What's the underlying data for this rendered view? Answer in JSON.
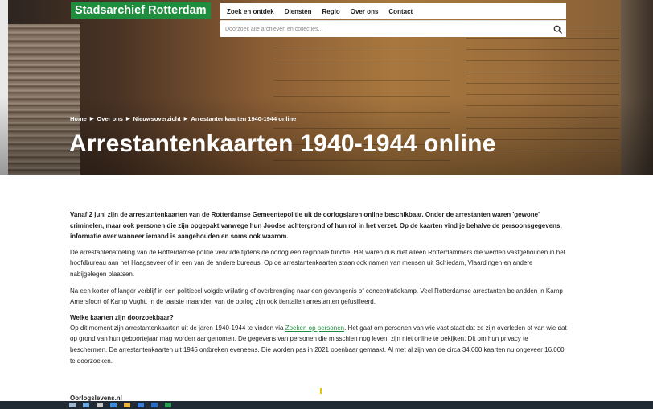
{
  "header": {
    "logo_text": "Stadsarchief Rotterdam",
    "nav": [
      {
        "label": "Zoek en ontdek"
      },
      {
        "label": "Diensten"
      },
      {
        "label": "Regio"
      },
      {
        "label": "Over ons"
      },
      {
        "label": "Contact"
      }
    ],
    "search_placeholder": "Doorzoek alle archieven en collecties...",
    "search_icon": "search-icon"
  },
  "breadcrumb": [
    "Home",
    "Over ons",
    "Nieuwsoverzicht",
    "Arrestantenkaarten 1940-1944 online"
  ],
  "page_title": "Arrestantenkaarten 1940-1944 online",
  "article": {
    "intro": "Vanaf 2 juni zijn de arrestantenkaarten van de Rotterdamse Gemeentepolitie uit de oorlogsjaren online beschikbaar. Onder de arrestanten waren 'gewone' criminelen, maar ook personen die zijn opgepakt vanwege hun Joodse achtergrond of hun rol in het verzet. Op de kaarten vind je behalve de persoonsgegevens, informatie over wanneer iemand is aangehouden en soms ook waarom.",
    "p1": "De arrestantenafdeling van de Rotterdamse politie vervulde tijdens de oorlog een regionale functie. Het waren dus niet alleen Rotterdammers die werden vastgehouden in het hoofdbureau aan het Haagseveer of in een van de andere bureaus. Op de arrestantenkaarten staan ook namen van mensen uit Schiedam, Vlaardingen en andere nabijgelegen plaatsen.",
    "p2": "Na een korter of langer verblijf in een politiecel volgde vrijlating of overbrenging naar een gevangenis of concentratiekamp. Veel Rotterdamse arrestanten belandden in Kamp Amersfoort of Kamp Vught. In de laatste maanden van de oorlog zijn ook tientallen arrestanten gefusilleerd.",
    "section_title": "Welke kaarten zijn doorzoekbaar?",
    "p3_before": "Op dit moment zijn arrestantenkaarten uit de jaren 1940-1944 te vinden via ",
    "p3_link": "Zoeken op personen",
    "p3_after": ". Het gaat om personen van wie vast staat dat ze zijn overleden of van wie dat op grond van hun geboortejaar mag worden aangenomen. De gegevens van personen die misschien nog leven, zijn niet online te bekijken. Dit om hun privacy te beschermen. De arrestantenkaarten uit 1945 ontbreken eveneens. Die worden pas in 2021 openbaar gemaakt. Al met al zijn van de circa 34.000 kaarten nu ongeveer 16.000 te doorzoeken.",
    "next_heading": "Oorlogslevens.nl"
  },
  "colors": {
    "brand_green": "#1e8e3e",
    "taskbar": "#202a34"
  }
}
